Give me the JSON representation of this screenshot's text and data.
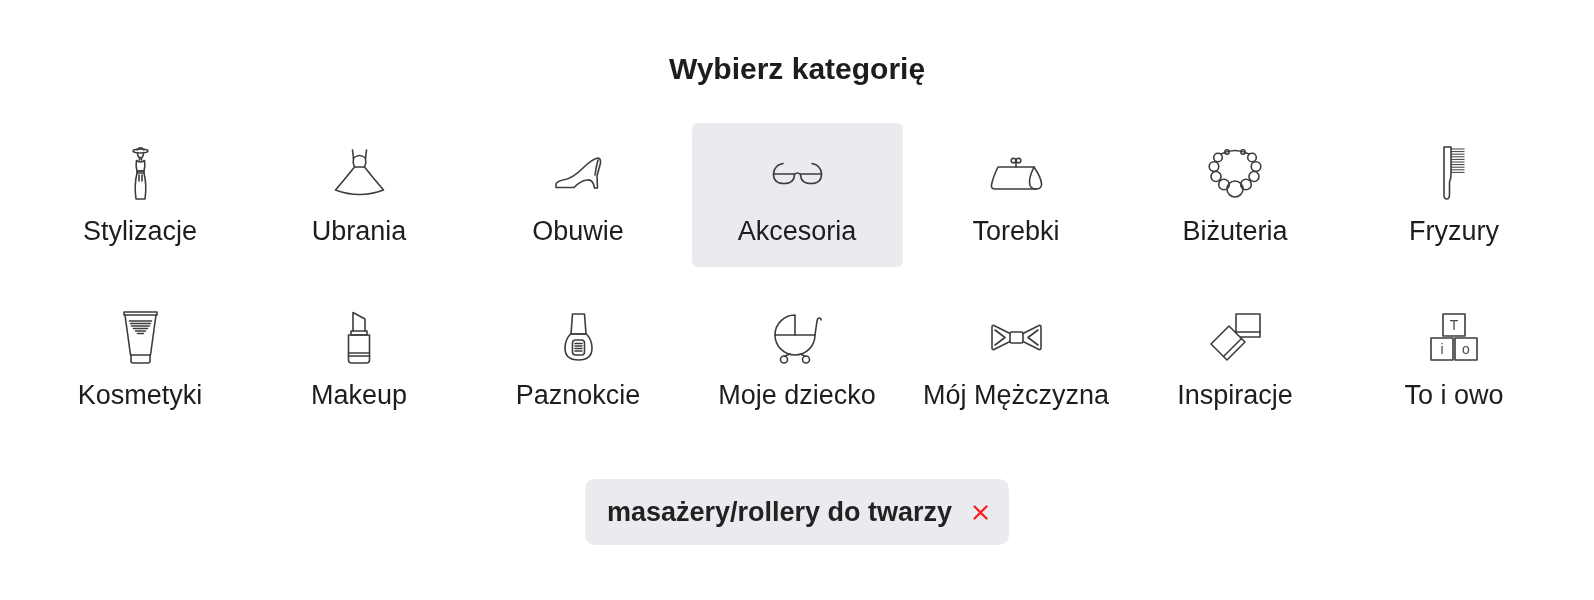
{
  "title": "Wybierz kategorię",
  "categories": [
    {
      "label": "Stylizacje",
      "selected": false
    },
    {
      "label": "Ubrania",
      "selected": false
    },
    {
      "label": "Obuwie",
      "selected": false
    },
    {
      "label": "Akcesoria",
      "selected": true
    },
    {
      "label": "Torebki",
      "selected": false
    },
    {
      "label": "Biżuteria",
      "selected": false
    },
    {
      "label": "Fryzury",
      "selected": false
    },
    {
      "label": "Kosmetyki",
      "selected": false
    },
    {
      "label": "Makeup",
      "selected": false
    },
    {
      "label": "Paznokcie",
      "selected": false
    },
    {
      "label": "Moje dziecko",
      "selected": false
    },
    {
      "label": "Mój Mężczyzna",
      "selected": false
    },
    {
      "label": "Inspiracje",
      "selected": false
    },
    {
      "label": "To i owo",
      "selected": false,
      "icon_letters": [
        "T",
        "i",
        "o"
      ]
    }
  ],
  "filter_tag": {
    "label": "masażery/rollery do twarzy"
  }
}
